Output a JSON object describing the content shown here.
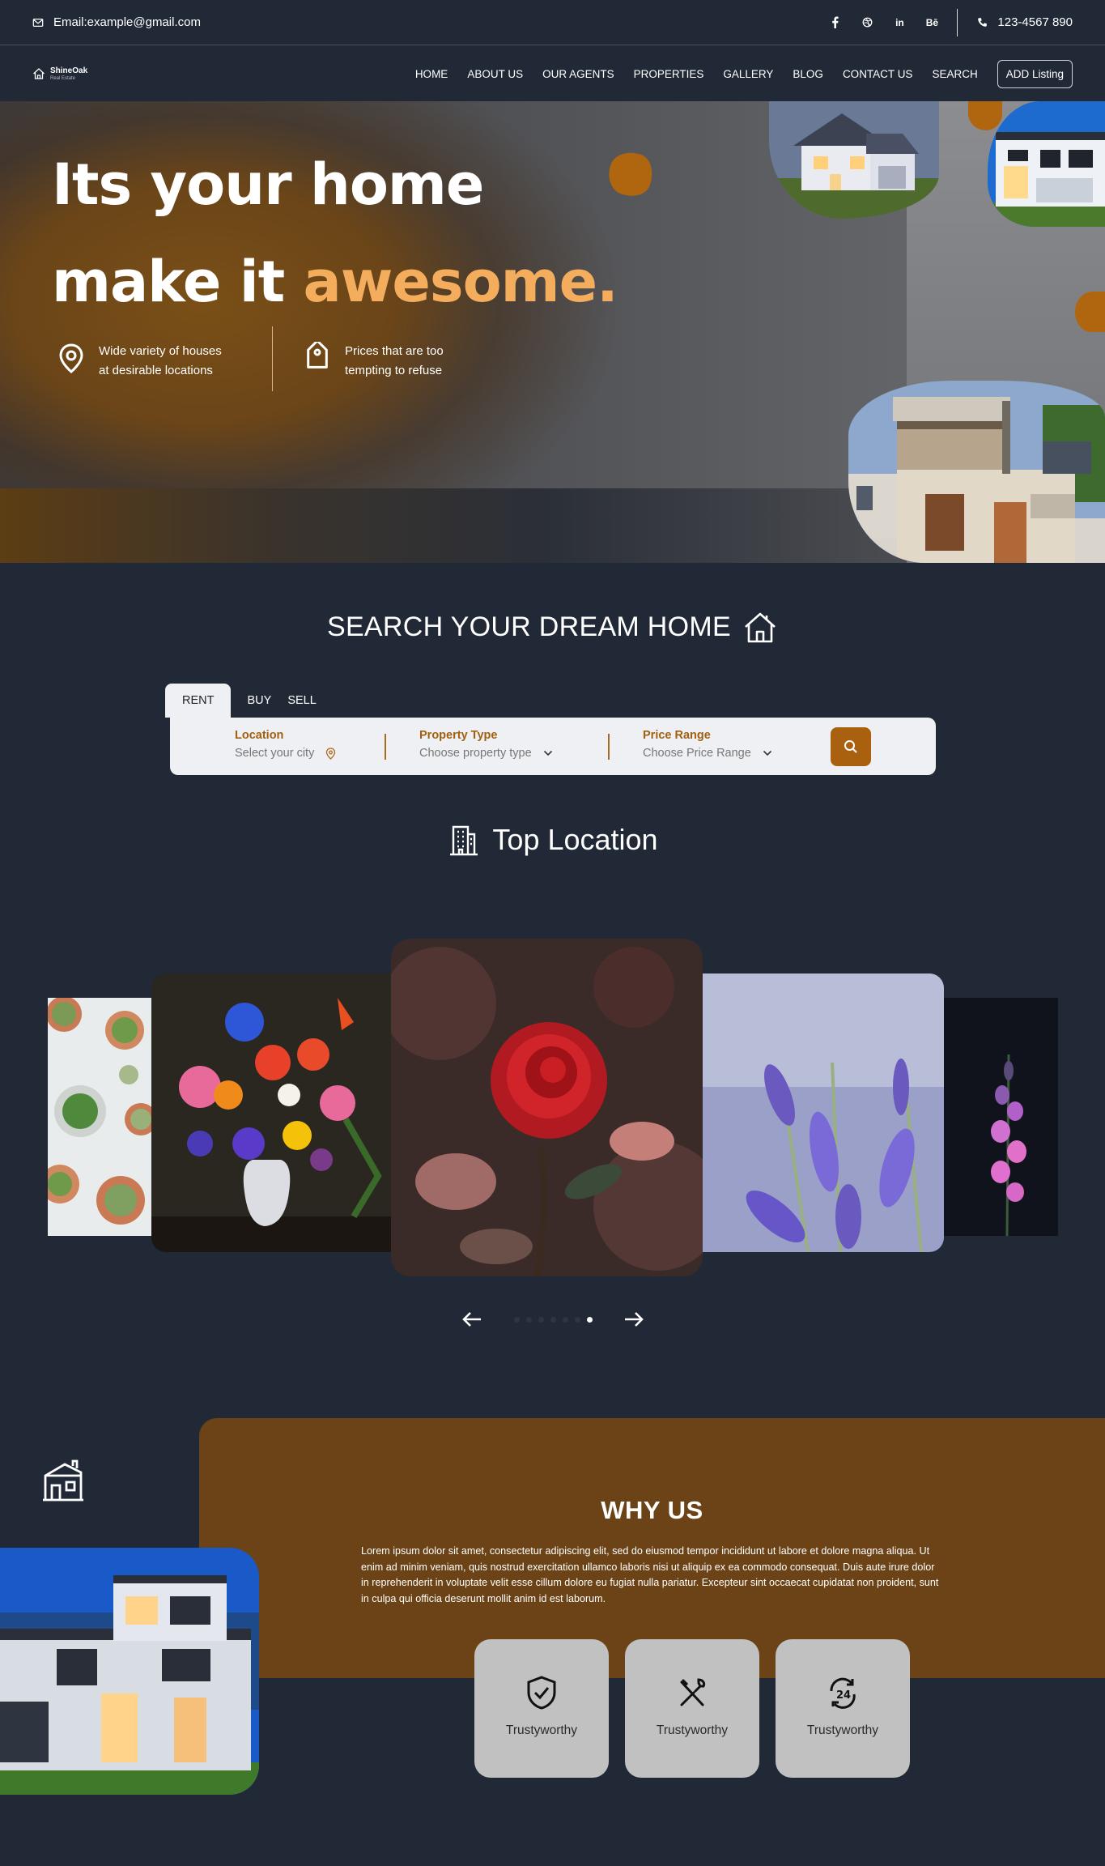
{
  "topbar": {
    "email": "Email:example@gmail.com",
    "social": [
      "facebook-icon",
      "dribbble-icon",
      "in",
      "Bē"
    ],
    "phone": "123-4567 890"
  },
  "nav": {
    "logo_name": "ShineOak",
    "logo_tagline": "Real Estate",
    "items": [
      "HOME",
      "ABOUT US",
      "OUR AGENTS",
      "PROPERTIES",
      "GALLERY",
      "BLOG",
      "CONTACT US",
      "SEARCH"
    ],
    "add_listing": "ADD Listing"
  },
  "hero": {
    "line1": "Its your home",
    "line2_plain": "make it ",
    "line2_accent": "awesome.",
    "feature1_l1": "Wide variety of houses",
    "feature1_l2": "at desirable locations",
    "feature2_l1": "Prices that are too",
    "feature2_l2": "tempting to refuse"
  },
  "search": {
    "title": "SEARCH YOUR DREAM HOME",
    "tabs": [
      "RENT",
      "BUY",
      "SELL"
    ],
    "active_tab": "RENT",
    "location_label": "Location",
    "location_value": "Select your city",
    "type_label": "Property Type",
    "type_value": "Choose property type",
    "price_label": "Price Range",
    "price_value": "Choose Price Range"
  },
  "top_location": {
    "title": "Top Location",
    "slide_count": 7,
    "active_slide": 7
  },
  "why": {
    "title": "WHY US",
    "text": "Lorem ipsum dolor sit amet, consectetur adipiscing elit, sed do eiusmod tempor incididunt ut labore et dolore magna aliqua. Ut enim ad minim veniam, quis nostrud exercitation ullamco laboris nisi ut aliquip ex ea commodo consequat. Duis aute irure dolor in reprehenderit in voluptate velit esse cillum dolore eu fugiat nulla pariatur. Excepteur sint occaecat cupidatat non proident, sunt in culpa qui officia deserunt mollit anim id est laborum.",
    "cards": [
      "Trustyworthy",
      "Trustyworthy",
      "Trustyworthy"
    ]
  },
  "colors": {
    "background": "#212937",
    "accent": "#a9610f",
    "accent_light": "#f4ad5d",
    "why_box": "#6b4316",
    "card": "#c1c1c1"
  }
}
